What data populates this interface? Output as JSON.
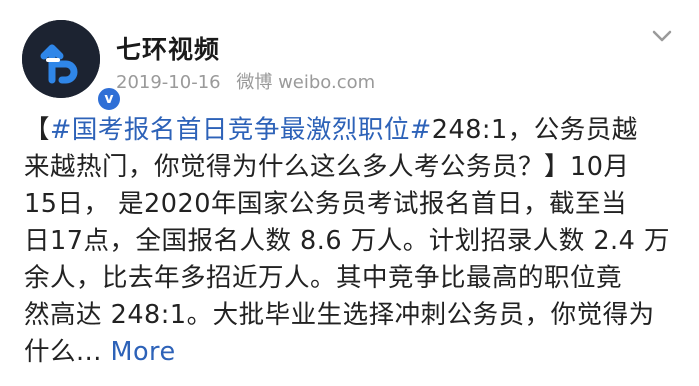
{
  "user": {
    "name": "七环视频",
    "date": "2019-10-16",
    "source": "微博 weibo.com",
    "verified_badge": "v"
  },
  "colors": {
    "link": "#2d62b8",
    "meta": "#9a9a9a",
    "text": "#222222"
  },
  "icons": {
    "menu": "chevron-down-icon",
    "avatar": "logo-avatar"
  },
  "post": {
    "lines": [
      {
        "prefix": "【",
        "topic": "#国考报名首日竞争最激烈职位#",
        "rest": "248:1，公务员越"
      },
      {
        "text": "来越热门，你觉得为什么这么多人考公务员？】10月"
      },
      {
        "text": "15日， 是2020年国家公务员考试报名首日，截至当"
      },
      {
        "text": "日17点，全国报名人数 8.6 万人。计划招录人数 2.4 万"
      },
      {
        "text": "余人，比去年多招近万人。其中竞争比最高的职位竟"
      },
      {
        "text": "然高达 248:1。大批毕业生选择冲刺公务员，你觉得为"
      },
      {
        "text": "什么... ",
        "more": "More"
      }
    ]
  }
}
